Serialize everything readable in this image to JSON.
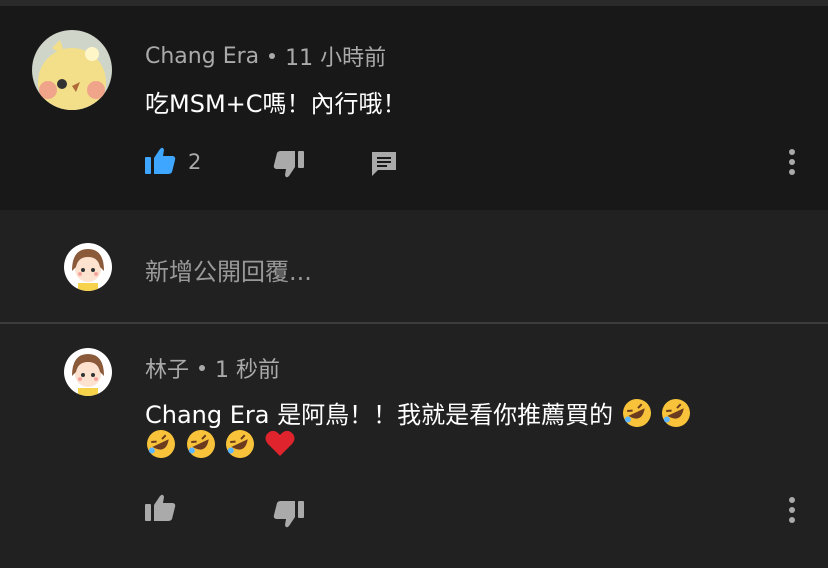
{
  "comments": [
    {
      "author": "Chang Era",
      "time": "11 小時前",
      "text": "吃MSM+C嗎！內行哦！",
      "like_count": "2"
    },
    {
      "author": "林子",
      "time": "1 秒前",
      "text_line1": "Chang Era 是阿鳥！！我就是看你推薦買的",
      "like_count": ""
    }
  ],
  "reply": {
    "placeholder": "新增公開回覆..."
  },
  "icons": {
    "like": "thumbs-up-icon",
    "dislike": "thumbs-down-icon",
    "reply": "comment-icon",
    "more": "more-vertical-icon",
    "emoji_laugh": "rolling-on-floor-laughing-emoji",
    "emoji_heart": "red-heart-emoji"
  },
  "colors": {
    "like_active": "#3ea6ff",
    "icon": "#aaaaaa",
    "muted": "#aaaaaa"
  }
}
